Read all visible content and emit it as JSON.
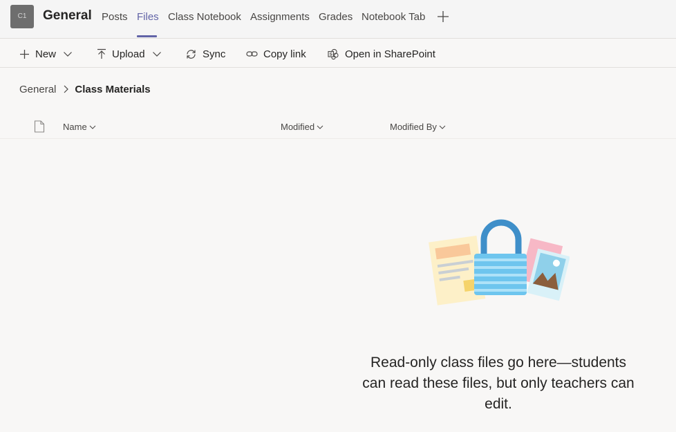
{
  "header": {
    "avatar_text": "C1",
    "channel_title": "General",
    "tabs": [
      {
        "label": "Posts"
      },
      {
        "label": "Files"
      },
      {
        "label": "Class Notebook"
      },
      {
        "label": "Assignments"
      },
      {
        "label": "Grades"
      },
      {
        "label": "Notebook Tab"
      }
    ],
    "active_tab": "Files",
    "add_tab_icon": "plus-icon"
  },
  "toolbar": {
    "new_label": "New",
    "upload_label": "Upload",
    "sync_label": "Sync",
    "copy_link_label": "Copy link",
    "open_sharepoint_label": "Open in SharePoint"
  },
  "breadcrumb": {
    "root": "General",
    "current": "Class Materials"
  },
  "columns": {
    "name": "Name",
    "modified": "Modified",
    "modified_by": "Modified By"
  },
  "empty_state": {
    "message": "Read-only class files go here—students can read these files, but only teachers can edit.",
    "illustration": "lock-with-documents-illustration"
  },
  "colors": {
    "accent": "#6264a7",
    "text": "#252423",
    "background": "#f8f7f6"
  }
}
